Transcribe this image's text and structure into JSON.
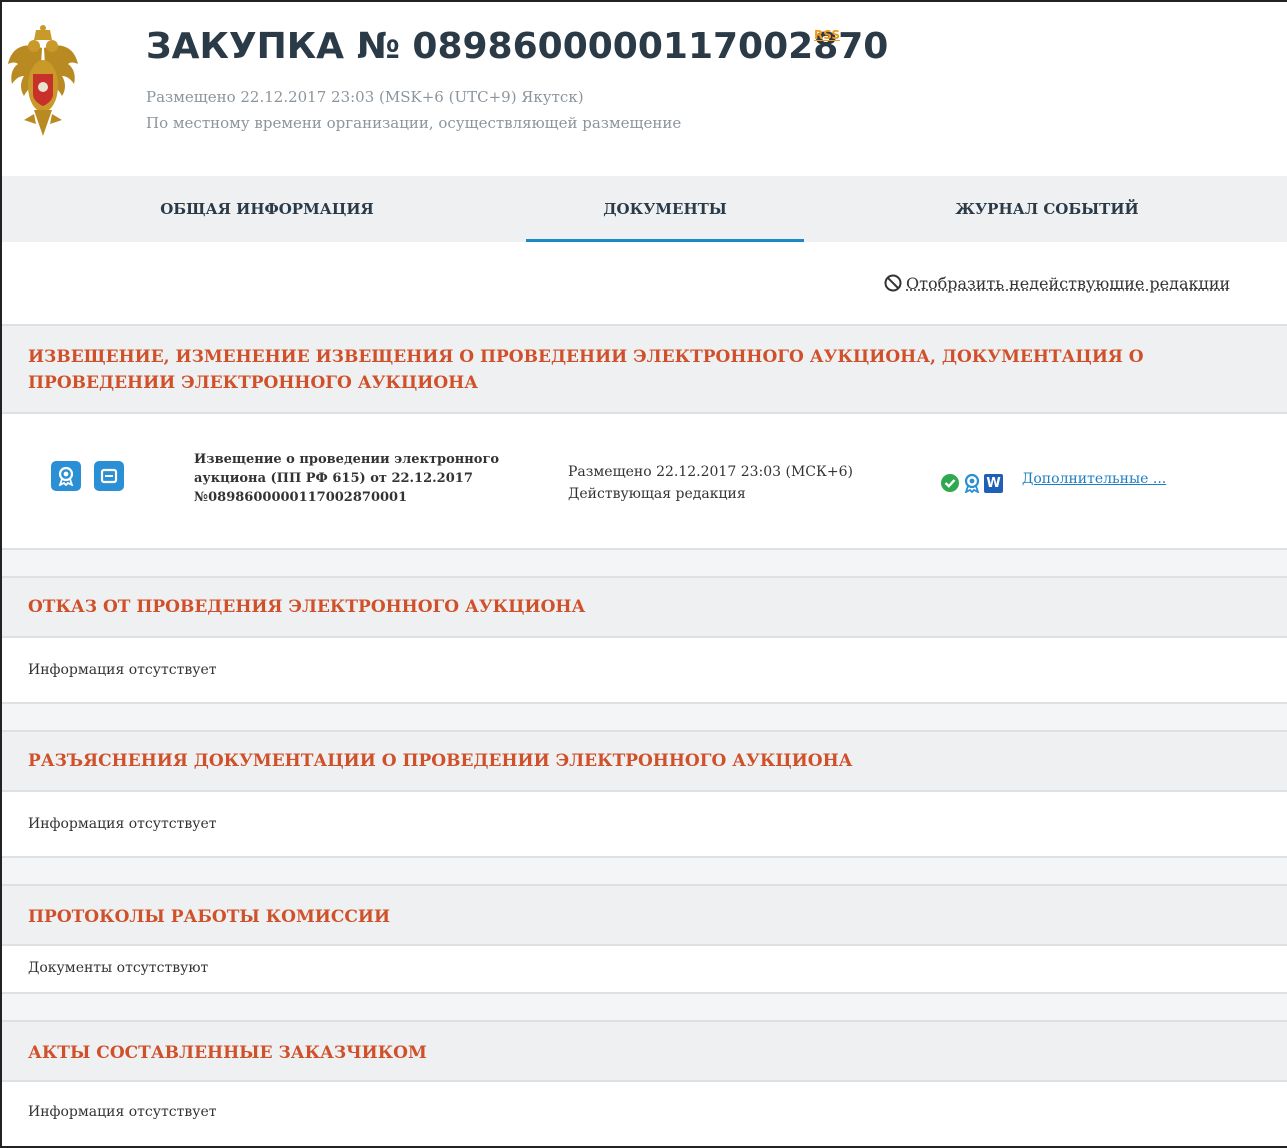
{
  "header": {
    "title": "ЗАКУПКА № 0898600000117002870",
    "rss_label": "RSS",
    "placed": "Размещено 22.12.2017 23:03 (MSK+6 (UTC+9) Якутск)",
    "local_time_note": "По местному времени организации, осуществляющей размещение"
  },
  "tabs": [
    {
      "label": "ОБЩАЯ ИНФОРМАЦИЯ"
    },
    {
      "label": "ДОКУМЕНТЫ"
    },
    {
      "label": "ЖУРНАЛ СОБЫТИЙ"
    }
  ],
  "active_tab": "ДОКУМЕНТЫ",
  "toggle_label": "Отобразить недействующие редакции",
  "sections": [
    {
      "title": "ИЗВЕЩЕНИЕ, ИЗМЕНЕНИЕ ИЗВЕЩЕНИЯ О ПРОВЕДЕНИИ ЭЛЕКТРОННОГО АУКЦИОНА, ДОКУМЕНТАЦИЯ О ПРОВЕДЕНИИ ЭЛЕКТРОННОГО АУКЦИОНА"
    },
    {
      "title": "ОТКАЗ ОТ ПРОВЕДЕНИЯ ЭЛЕКТРОННОГО АУКЦИОНА",
      "empty_text": "Информация отсутствует"
    },
    {
      "title": "РАЗЪЯСНЕНИЯ ДОКУМЕНТАЦИИ О ПРОВЕДЕНИИ ЭЛЕКТРОННОГО АУКЦИОНА",
      "empty_text": "Информация отсутствует"
    },
    {
      "title": "ПРОТОКОЛЫ РАБОТЫ КОМИССИИ",
      "empty_text": "Документы отсутствуют"
    },
    {
      "title": "АКТЫ СОСТАВЛЕННЫЕ ЗАКАЗЧИКОМ",
      "empty_text": "Информация отсутствует"
    }
  ],
  "document": {
    "name_line1": "Извещение о проведении электронного",
    "name_line2": "аукциона (ПП РФ 615) от 22.12.2017",
    "name_line3": "№0898600000117002870001",
    "placed": "Размещено 22.12.2017 23:03 (МСК+6)",
    "status": "Действующая редакция",
    "more_link": "Дополнительные ...",
    "word_icon_letter": "W",
    "icons": [
      "certificate-icon",
      "print-icon",
      "check-circle-icon",
      "certificate-icon",
      "word-doc-icon"
    ]
  },
  "colors": {
    "title": "#2b3a47",
    "section_title": "#d0502a",
    "accent_blue": "#1e88c7",
    "rss": "#f39a1e",
    "check_green": "#2fa84f",
    "section_bg": "#eef0f2"
  }
}
